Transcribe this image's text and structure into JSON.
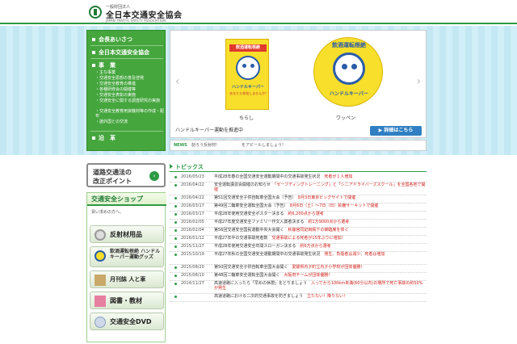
{
  "header": {
    "org_small": "一般財団法人",
    "org_name": "全日本交通安全協会",
    "org_en": "JAPAN TRAFFIC SAFETY ASSOCIATION"
  },
  "leftnav": {
    "items": [
      {
        "label": "会長あいさつ"
      },
      {
        "label": "全日本交通安全協会"
      },
      {
        "label": "事　業"
      },
      {
        "label": "沿　革"
      }
    ],
    "sub_items": [
      "主な事業",
      "交通安全思想の普及啓発",
      "交通安全教育の推進",
      "各種研修会の開催等",
      "交通安全表彰の実施",
      "交通安全に関する調査研究の実施",
      "交通安全教育用資機材等の作成・配布",
      "諸外国との交流"
    ]
  },
  "hero": {
    "flyer_band": "飲酒運転根絶",
    "flyer_title": "ハンドルキーパー",
    "flyer_sub": "あなたも参加しませんか!",
    "sticker_arc": "飲酒運転根絶",
    "sticker_bottom": "ハンドルキーパー",
    "caption_flyer": "ちらし",
    "caption_sticker": "ワッペン",
    "description": "ハンドルキーパー運動を推進中",
    "detail_button": "詳細はこちら"
  },
  "news": {
    "label": "NEWS",
    "headline": "創ろう反射材!",
    "text": "をアピールしましょう!"
  },
  "sidebar": {
    "reform_line1": "道路交通法の",
    "reform_line2": "改正ポイント",
    "shop_title": "交通安全ショップ",
    "shop_sub": "買い求めの方へ。",
    "buttons": [
      {
        "label": "反射材用品"
      },
      {
        "label": "飲酒運転根絶 ハンドルキーパー運動グッズ"
      },
      {
        "label": "月刊誌 人と車"
      },
      {
        "label": "図書・教材"
      },
      {
        "label": "交通安全DVD"
      }
    ]
  },
  "topics": {
    "title": "トピックス",
    "rows": [
      {
        "date": "2016/05/23",
        "text": "平成28年春の全国交通安全運動期間中の交通事故発生状況",
        "red": "死者が１人増加"
      },
      {
        "date": "2016/04/22",
        "text": "安全運転講習会開催のお知らせ",
        "red": "「セーフティングトレーニング」と「シニアドライバーズスクール」を全国各地で開催"
      },
      {
        "date": "2016/04/22",
        "text": "第51回交通安全子供自転車全国大会（予告）",
        "red": "8月3日東京ビッグサイトで開催"
      },
      {
        "date": "2016/03/17",
        "text": "第49回二輪車安全運転全国大会（予告）",
        "red": "8月6日（土）〜7日（日）鈴鹿サーキットで開催"
      },
      {
        "date": "2016/03/17",
        "text": "平成28年使用交通安全ポスター決まる",
        "red": "約6,200点から選考"
      },
      {
        "date": "2016/02/05",
        "text": "平成27年度交通安全ファミリー作文入賞者決まる",
        "red": "約1万9000点から選考"
      },
      {
        "date": "2016/02/04",
        "text": "第56回交通安全国民運動中央大会開く",
        "red": "秋篠宮同妃両殿下の御臨席を仰ぐ"
      },
      {
        "date": "2016/01/12",
        "text": "平成27年中の交通事故死者数",
        "red": "交通事故による死者が15年ぶりに増加！"
      },
      {
        "date": "2015/11/27",
        "text": "平成28年使用交通安全年間スローガン決まる",
        "red": "約6万点から選考"
      },
      {
        "date": "2015/10/19",
        "text": "平成27年秋の全国交通安全運動期間中の交通事故発生状況",
        "red": "発生、負傷者は減少、死者は増加"
      },
      {
        "date": "2015/08/20",
        "text": "第50回交通安全子供自転車全国大会開く",
        "red": "愛媛県内子町立内子小学校が団体優勝！"
      },
      {
        "date": "2015/08/10",
        "text": "第48回二輪車安全運転全国大会開く",
        "red": "大阪府チームが団体優勝！"
      },
      {
        "date": "2014/11/27",
        "text": "高速道路に入ったら「早めの休憩」をとりましょう",
        "red": "入ってから100km未満(60分以内)の場所で死亡事故の約50%が発生"
      },
      {
        "date": "",
        "text": "高速道路における二次的交通事故を防ぎましょう",
        "red": "立たない！降りない！"
      }
    ]
  },
  "colors": {
    "brand_green": "#2f9a46",
    "accent_red": "#d0211c",
    "button_blue": "#2f7fc2"
  }
}
